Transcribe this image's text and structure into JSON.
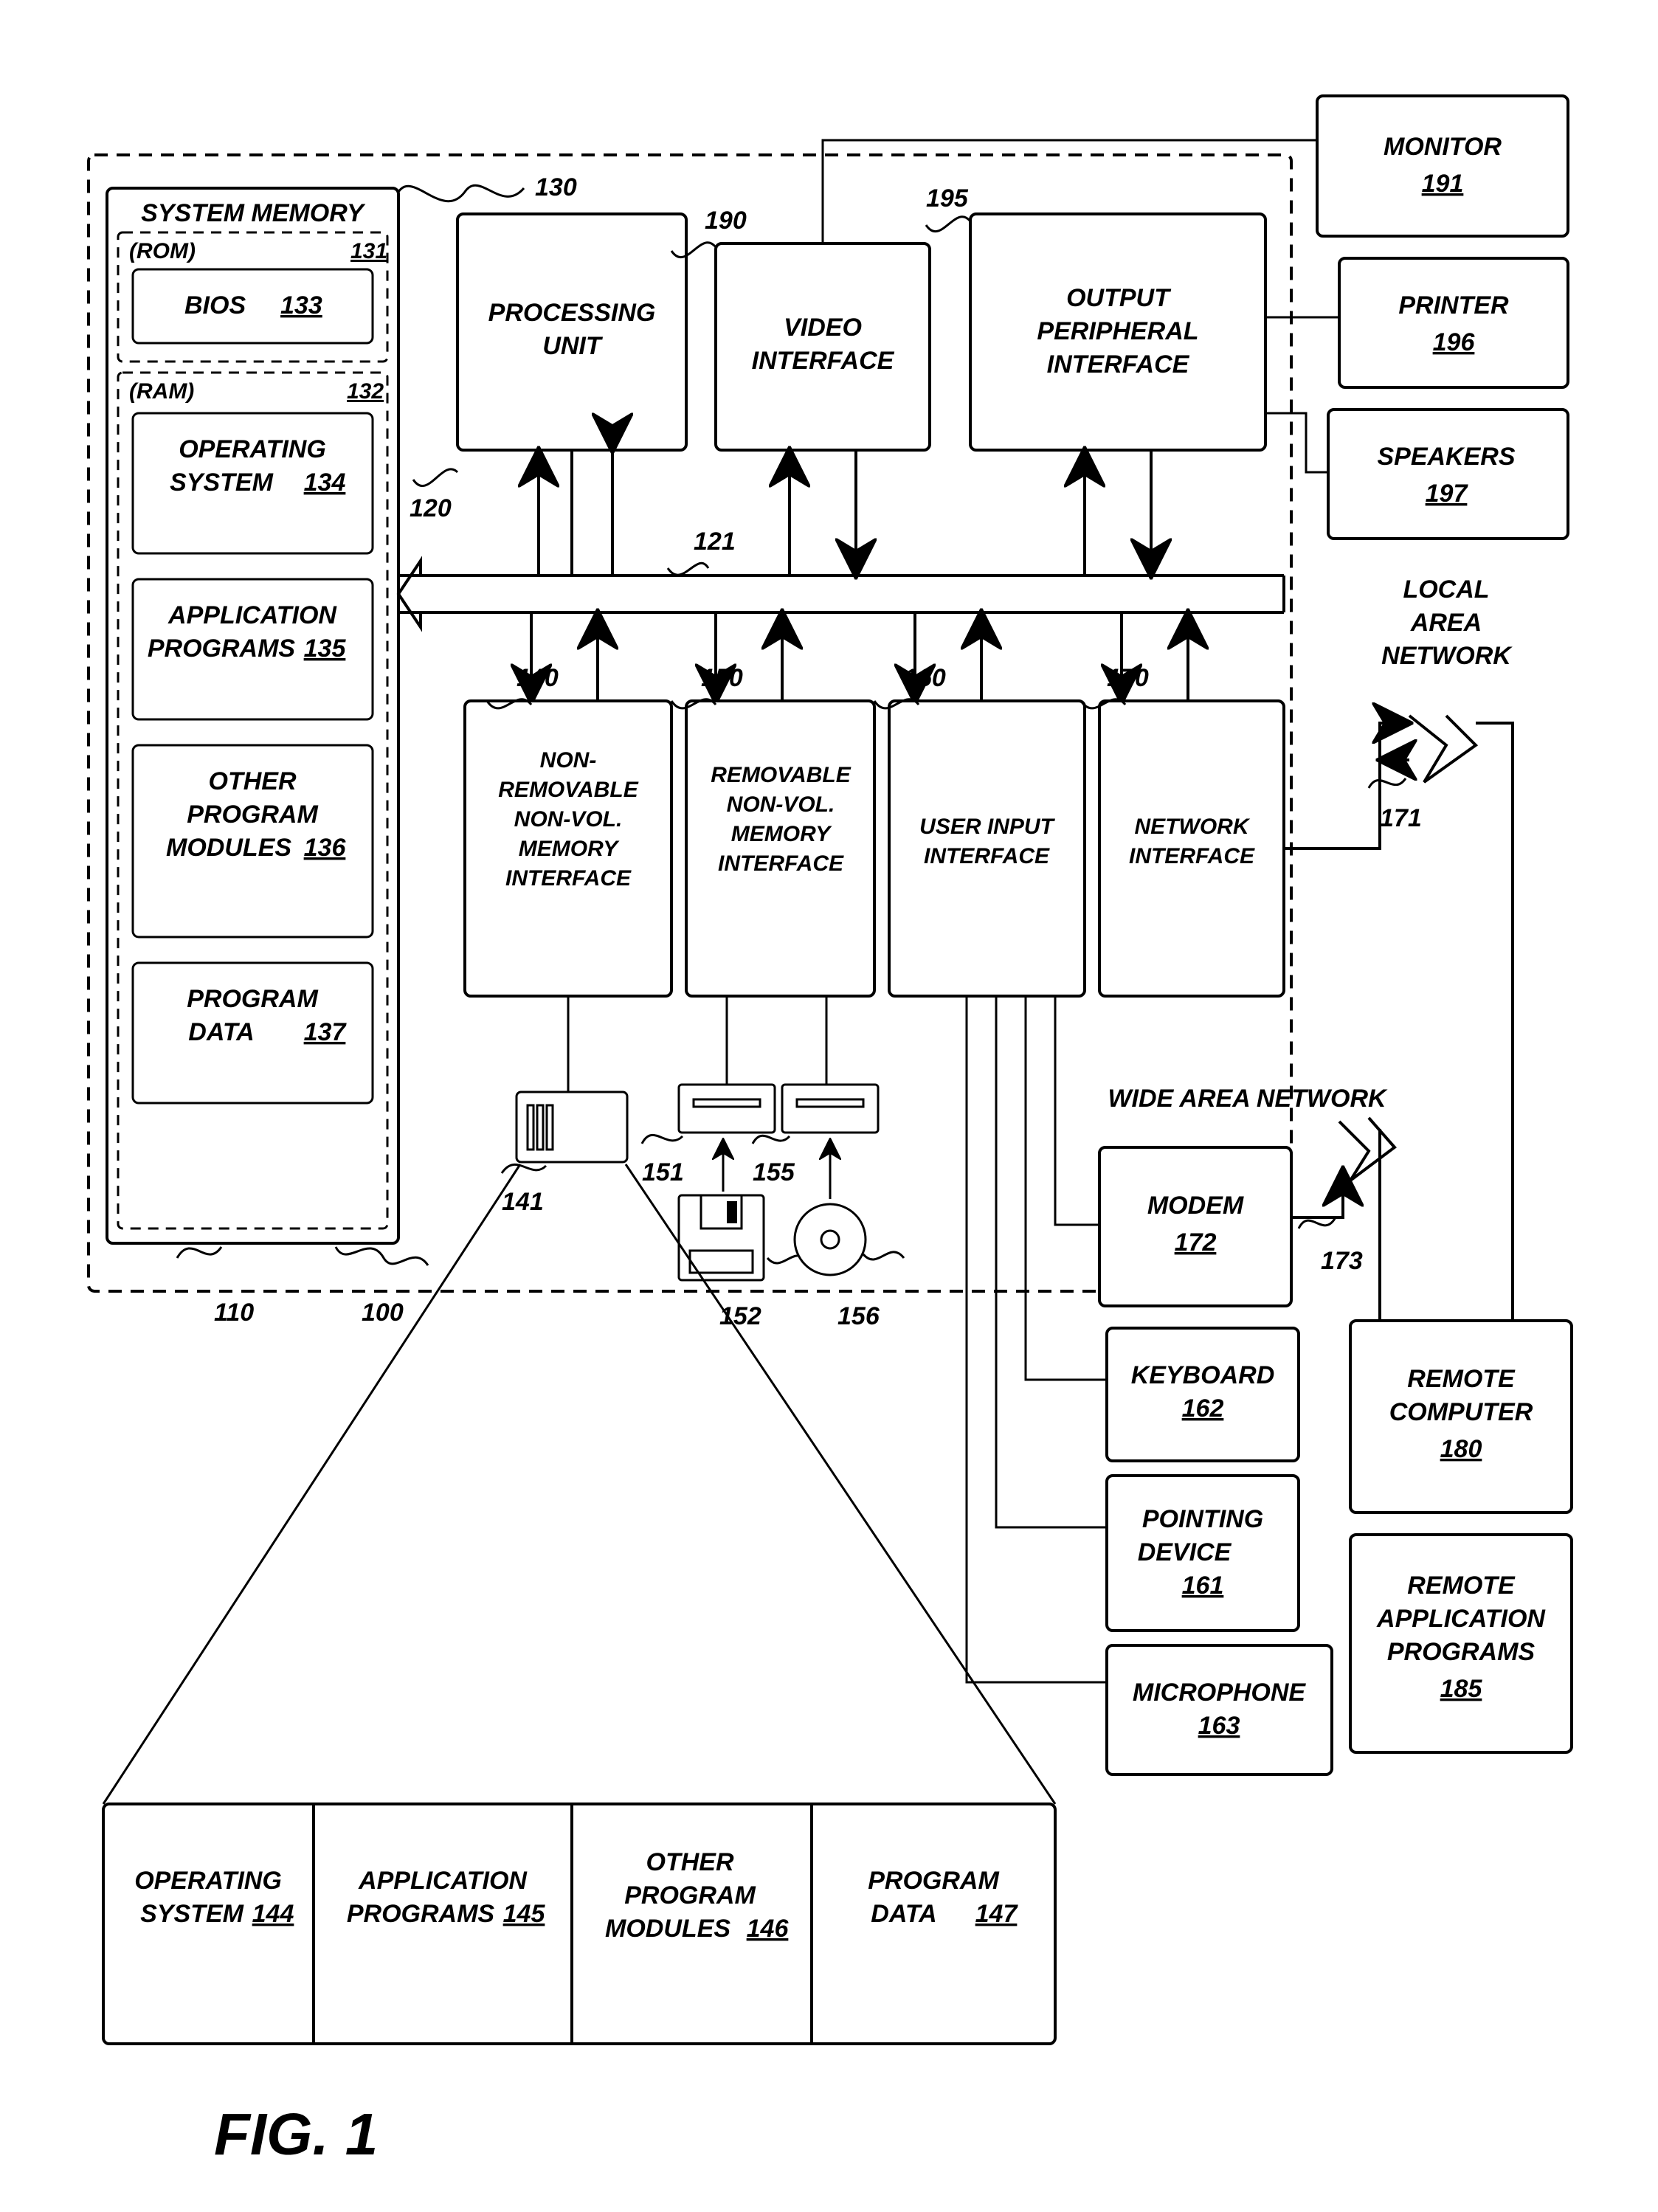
{
  "figure_label": "FIG. 1",
  "sysmem": {
    "title": "SYSTEM MEMORY",
    "rom": "(ROM)",
    "rom_ref": "131",
    "bios": "BIOS",
    "bios_ref": "133",
    "ram": "(RAM)",
    "ram_ref": "132",
    "os": "OPERATING",
    "os2": "SYSTEM",
    "os_ref": "134",
    "app1": "APPLICATION",
    "app2": "PROGRAMS",
    "app_ref": "135",
    "oth1": "OTHER",
    "oth2": "PROGRAM",
    "oth3": "MODULES",
    "oth_ref": "136",
    "pd1": "PROGRAM",
    "pd2": "DATA",
    "pd_ref": "137"
  },
  "blocks": {
    "processing": {
      "l1": "PROCESSING",
      "l2": "UNIT"
    },
    "video": {
      "l1": "VIDEO",
      "l2": "INTERFACE"
    },
    "out_periph": {
      "l1": "OUTPUT",
      "l2": "PERIPHERAL",
      "l3": "INTERFACE"
    },
    "nonrem": {
      "l1": "NON-",
      "l2": "REMOVABLE",
      "l3": "NON-VOL.",
      "l4": "MEMORY",
      "l5": "INTERFACE"
    },
    "rem": {
      "l1": "REMOVABLE",
      "l2": "NON-VOL.",
      "l3": "MEMORY",
      "l4": "INTERFACE"
    },
    "userin": {
      "l1": "USER INPUT",
      "l2": "INTERFACE"
    },
    "net": {
      "l1": "NETWORK",
      "l2": "INTERFACE"
    },
    "modem": {
      "l1": "MODEM",
      "ref": "172"
    },
    "keyboard": {
      "l1": "KEYBOARD",
      "ref": "162"
    },
    "pointing": {
      "l1": "POINTING",
      "l2": "DEVICE",
      "ref": "161"
    },
    "mic": {
      "l1": "MICROPHONE",
      "ref": "163"
    },
    "remote_comp": {
      "l1": "REMOTE",
      "l2": "COMPUTER",
      "ref": "180"
    },
    "remote_app": {
      "l1": "REMOTE",
      "l2": "APPLICATION",
      "l3": "PROGRAMS",
      "ref": "185"
    },
    "monitor": {
      "l1": "MONITOR",
      "ref": "191"
    },
    "printer": {
      "l1": "PRINTER",
      "ref": "196"
    },
    "speakers": {
      "l1": "SPEAKERS",
      "ref": "197"
    }
  },
  "labels": {
    "lan1": "LOCAL",
    "lan2": "AREA",
    "lan3": "NETWORK",
    "wan": "WIDE AREA NETWORK"
  },
  "refs": {
    "sysmem_arrow": "130",
    "processing": "120",
    "bus": "121",
    "video": "190",
    "out_periph": "195",
    "nonrem": "140",
    "rem": "150",
    "userin": "160",
    "net": "170",
    "main": "100",
    "sysmem_block": "110",
    "hdd": "141",
    "drive1": "151",
    "drive2": "155",
    "media1": "152",
    "media2": "156",
    "lan": "171",
    "wan": "173"
  },
  "strip": {
    "os1": "OPERATING",
    "os2": "SYSTEM",
    "os_ref": "144",
    "app1": "APPLICATION",
    "app2": "PROGRAMS",
    "app_ref": "145",
    "oth1": "OTHER",
    "oth2": "PROGRAM",
    "oth3": "MODULES",
    "oth_ref": "146",
    "pd1": "PROGRAM",
    "pd2": "DATA",
    "pd_ref": "147"
  }
}
